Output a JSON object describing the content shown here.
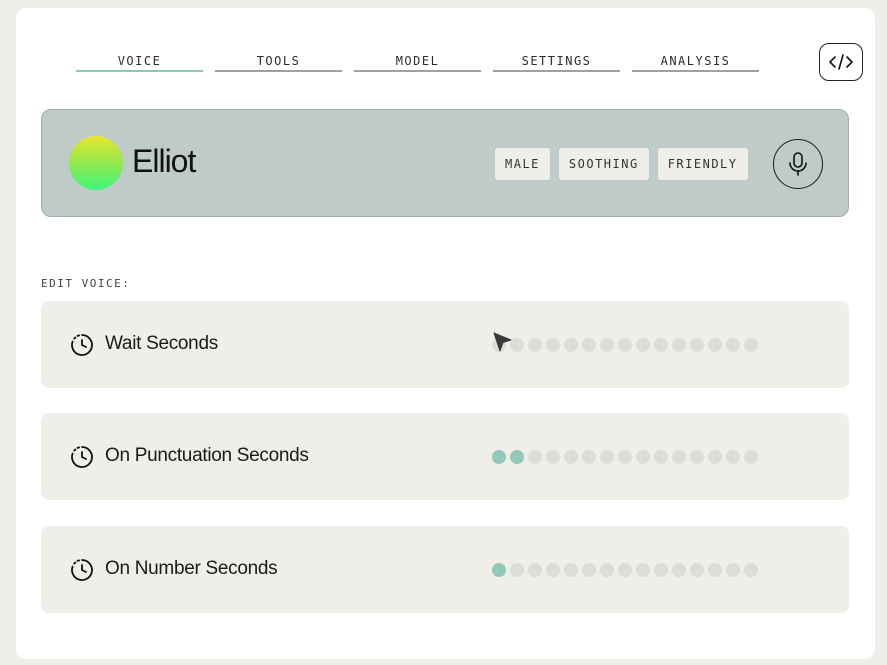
{
  "tabs": [
    {
      "label": "VOICE",
      "active": true
    },
    {
      "label": "TOOLS",
      "active": false
    },
    {
      "label": "MODEL",
      "active": false
    },
    {
      "label": "SETTINGS",
      "active": false
    },
    {
      "label": "ANALYSIS",
      "active": false
    }
  ],
  "code_button": {
    "icon": "code-icon"
  },
  "voice": {
    "name": "Elliot",
    "tags": [
      "MALE",
      "SOOTHING",
      "FRIENDLY"
    ],
    "mic_icon": "microphone-icon"
  },
  "edit_section": {
    "label": "EDIT VOICE:",
    "settings": [
      {
        "label": "Wait Seconds",
        "icon": "timer-icon",
        "level": 0,
        "steps": 15
      },
      {
        "label": "On Punctuation Seconds",
        "icon": "timer-icon",
        "level": 2,
        "steps": 15
      },
      {
        "label": "On Number Seconds",
        "icon": "timer-icon",
        "level": 1,
        "steps": 15
      }
    ]
  },
  "colors": {
    "accent": "#92c9bb",
    "voice_card_bg": "#bfcbc8",
    "row_bg": "#efeee9",
    "dot_off": "#dddcd7"
  }
}
